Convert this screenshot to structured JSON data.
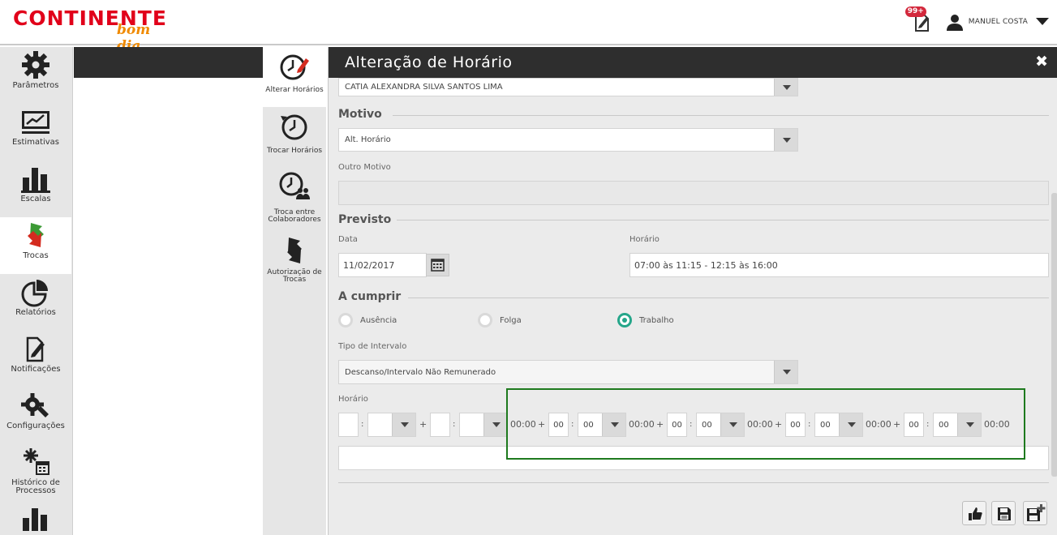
{
  "header": {
    "logo_main": "CONTINENTE",
    "logo_sub": "bom dia",
    "notif_badge": "99+",
    "user_name": "MANUEL COSTA"
  },
  "sidebar": {
    "items": [
      {
        "label": "Parâmetros",
        "icon": "gear-icon"
      },
      {
        "label": "Estimativas",
        "icon": "chart-board-icon"
      },
      {
        "label": "Escalas",
        "icon": "bar-chart-icon"
      },
      {
        "label": "Trocas",
        "icon": "swap-arrows-icon"
      },
      {
        "label": "Relatórios",
        "icon": "pie-chart-icon"
      },
      {
        "label": "Notificações",
        "icon": "notification-icon"
      },
      {
        "label": "Configurações",
        "icon": "wrench-gear-icon"
      },
      {
        "label_line1": "Histórico de",
        "label_line2": "Processos",
        "icon": "process-history-icon"
      }
    ]
  },
  "subsidebar": {
    "items": [
      {
        "label": "Alterar Horários"
      },
      {
        "label": "Trocar Horários"
      },
      {
        "label_line1": "Troca entre",
        "label_line2": "Colaboradores"
      },
      {
        "label_line1": "Autorização de",
        "label_line2": "Trocas"
      }
    ]
  },
  "panel": {
    "title": "Alteração de Horário",
    "employee": "CATIA ALEXANDRA SILVA SANTOS LIMA",
    "motivo_title": "Motivo",
    "motivo_value": "Alt. Horário",
    "outro_motivo_label": "Outro Motivo",
    "outro_motivo_value": "",
    "previsto_title": "Previsto",
    "data_label": "Data",
    "data_value": "11/02/2017",
    "horario_label": "Horário",
    "horario_value": "07:00 às 11:15 - 12:15 às 16:00",
    "cumprir_title": "A cumprir",
    "radios": [
      {
        "label": "Ausência",
        "checked": false
      },
      {
        "label": "Folga",
        "checked": false
      },
      {
        "label": "Trabalho",
        "checked": true
      }
    ],
    "tipo_intervalo_label": "Tipo de Intervalo",
    "tipo_intervalo_value": "Descanso/Intervalo Não Remunerado",
    "horario2_label": "Horário",
    "time_row": {
      "plus": "+",
      "colon": ":",
      "total": "00:00",
      "hour": "00",
      "minute": "00"
    }
  },
  "colors": {
    "brand_red": "#e1001a",
    "brand_orange": "#f08a00",
    "radio_active": "#25a68a",
    "highlight": "#1e7a1e",
    "header_dark": "#2e2e2e"
  }
}
